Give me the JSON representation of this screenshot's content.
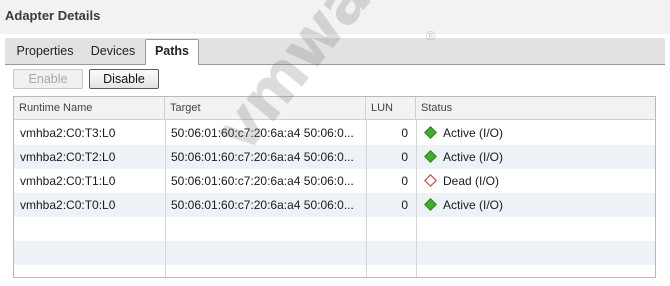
{
  "header": {
    "title": "Adapter Details"
  },
  "tabs": [
    {
      "label": "Properties"
    },
    {
      "label": "Devices"
    },
    {
      "label": "Paths"
    }
  ],
  "active_tab": "Paths",
  "toolbar": {
    "enable_label": "Enable",
    "disable_label": "Disable"
  },
  "table": {
    "columns": [
      "Runtime Name",
      "Target",
      "LUN",
      "Status"
    ],
    "rows": [
      {
        "runtime_name": "vmhba2:C0:T3:L0",
        "target": "50:06:01:60:c7:20:6a:a4 50:06:0...",
        "lun": "0",
        "status": "Active (I/O)",
        "status_icon": "green-diamond-icon"
      },
      {
        "runtime_name": "vmhba2:C0:T2:L0",
        "target": "50:06:01:60:c7:20:6a:a4 50:06:0...",
        "lun": "0",
        "status": "Active (I/O)",
        "status_icon": "green-diamond-icon"
      },
      {
        "runtime_name": "vmhba2:C0:T1:L0",
        "target": "50:06:01:60:c7:20:6a:a4 50:06:0...",
        "lun": "0",
        "status": "Dead (I/O)",
        "status_icon": "red-outline-diamond-icon"
      },
      {
        "runtime_name": "vmhba2:C0:T0:L0",
        "target": "50:06:01:60:c7:20:6a:a4 50:06:0...",
        "lun": "0",
        "status": "Active (I/O)",
        "status_icon": "green-diamond-icon"
      }
    ]
  },
  "watermark": {
    "text": "vmware",
    "mark": "®"
  },
  "colors": {
    "active_status": "#3fae2a",
    "dead_status": "#d9252a",
    "alt_row": "#eef2f7"
  }
}
